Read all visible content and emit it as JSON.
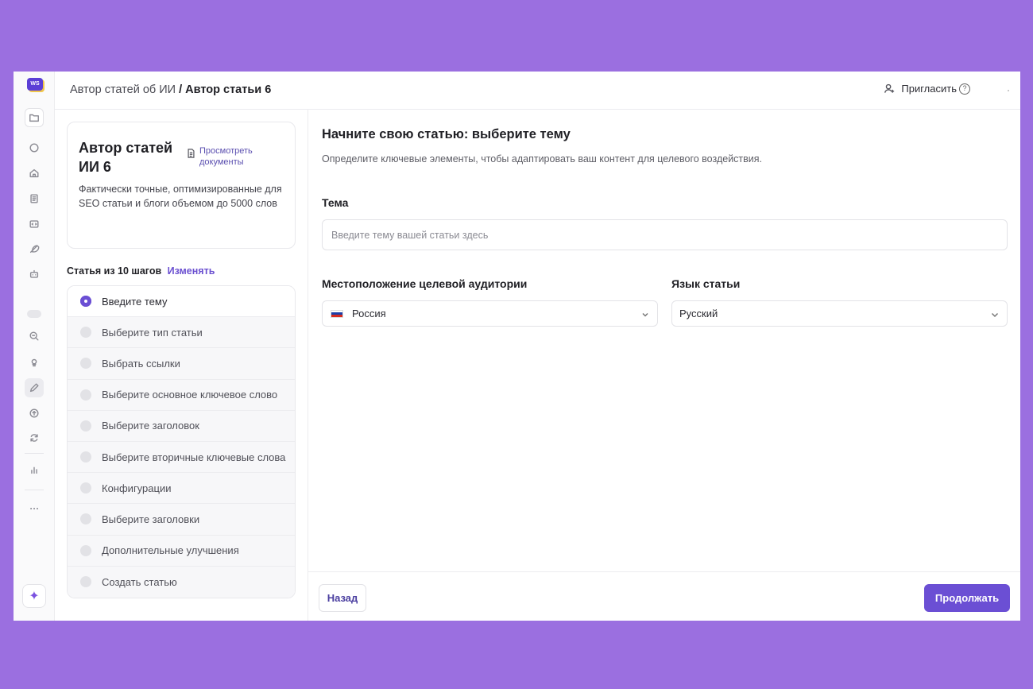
{
  "app": {
    "logo_text": "WS",
    "colors": {
      "accent": "#6b4fd4",
      "background": "#9b6fe0"
    }
  },
  "rail": {
    "icons": [
      "folder-icon",
      "loader-icon",
      "home-icon",
      "notebook-icon",
      "code-icon",
      "feather-icon",
      "robot-icon",
      "toggle-icon",
      "search-zoom-icon",
      "lightbulb-icon",
      "pencil-icon",
      "upload-icon",
      "refresh-icon",
      "bar-chart-icon",
      "more-icon",
      "sparkle-icon"
    ]
  },
  "header": {
    "breadcrumb_parent": "Автор статей об ИИ",
    "breadcrumb_sep": " / ",
    "breadcrumb_current": "Автор статьи 6",
    "invite_label": "Пригласить"
  },
  "card": {
    "title": "Автор статей ИИ 6",
    "docs_link": "Просмотреть документы",
    "description": "Фактически точные, оптимизированные для SEO статьи и блоги объемом до 5000 слов"
  },
  "steps": {
    "heading": "Статья из 10 шагов",
    "edit_label": "Изменять",
    "items": [
      {
        "label": "Введите тему",
        "active": true
      },
      {
        "label": "Выберите тип статьи"
      },
      {
        "label": "Выбрать ссылки"
      },
      {
        "label": "Выберите основное ключевое слово"
      },
      {
        "label": "Выберите заголовок"
      },
      {
        "label": "Выберите вторичные ключевые слова"
      },
      {
        "label": "Конфигурации"
      },
      {
        "label": "Выберите заголовки"
      },
      {
        "label": "Дополнительные улучшения"
      },
      {
        "label": "Создать статью"
      }
    ]
  },
  "main": {
    "title": "Начните свою статью: выберите тему",
    "subtitle": "Определите ключевые элементы, чтобы адаптировать ваш контент для целевого воздействия.",
    "topic": {
      "label": "Тема",
      "placeholder": "Введите тему вашей статьи здесь",
      "value": ""
    },
    "location": {
      "label": "Местоположение целевой аудитории",
      "value": "Россия"
    },
    "language": {
      "label": "Язык статьи",
      "value": "Русский"
    }
  },
  "footer": {
    "back_label": "Назад",
    "next_label": "Продолжать"
  }
}
